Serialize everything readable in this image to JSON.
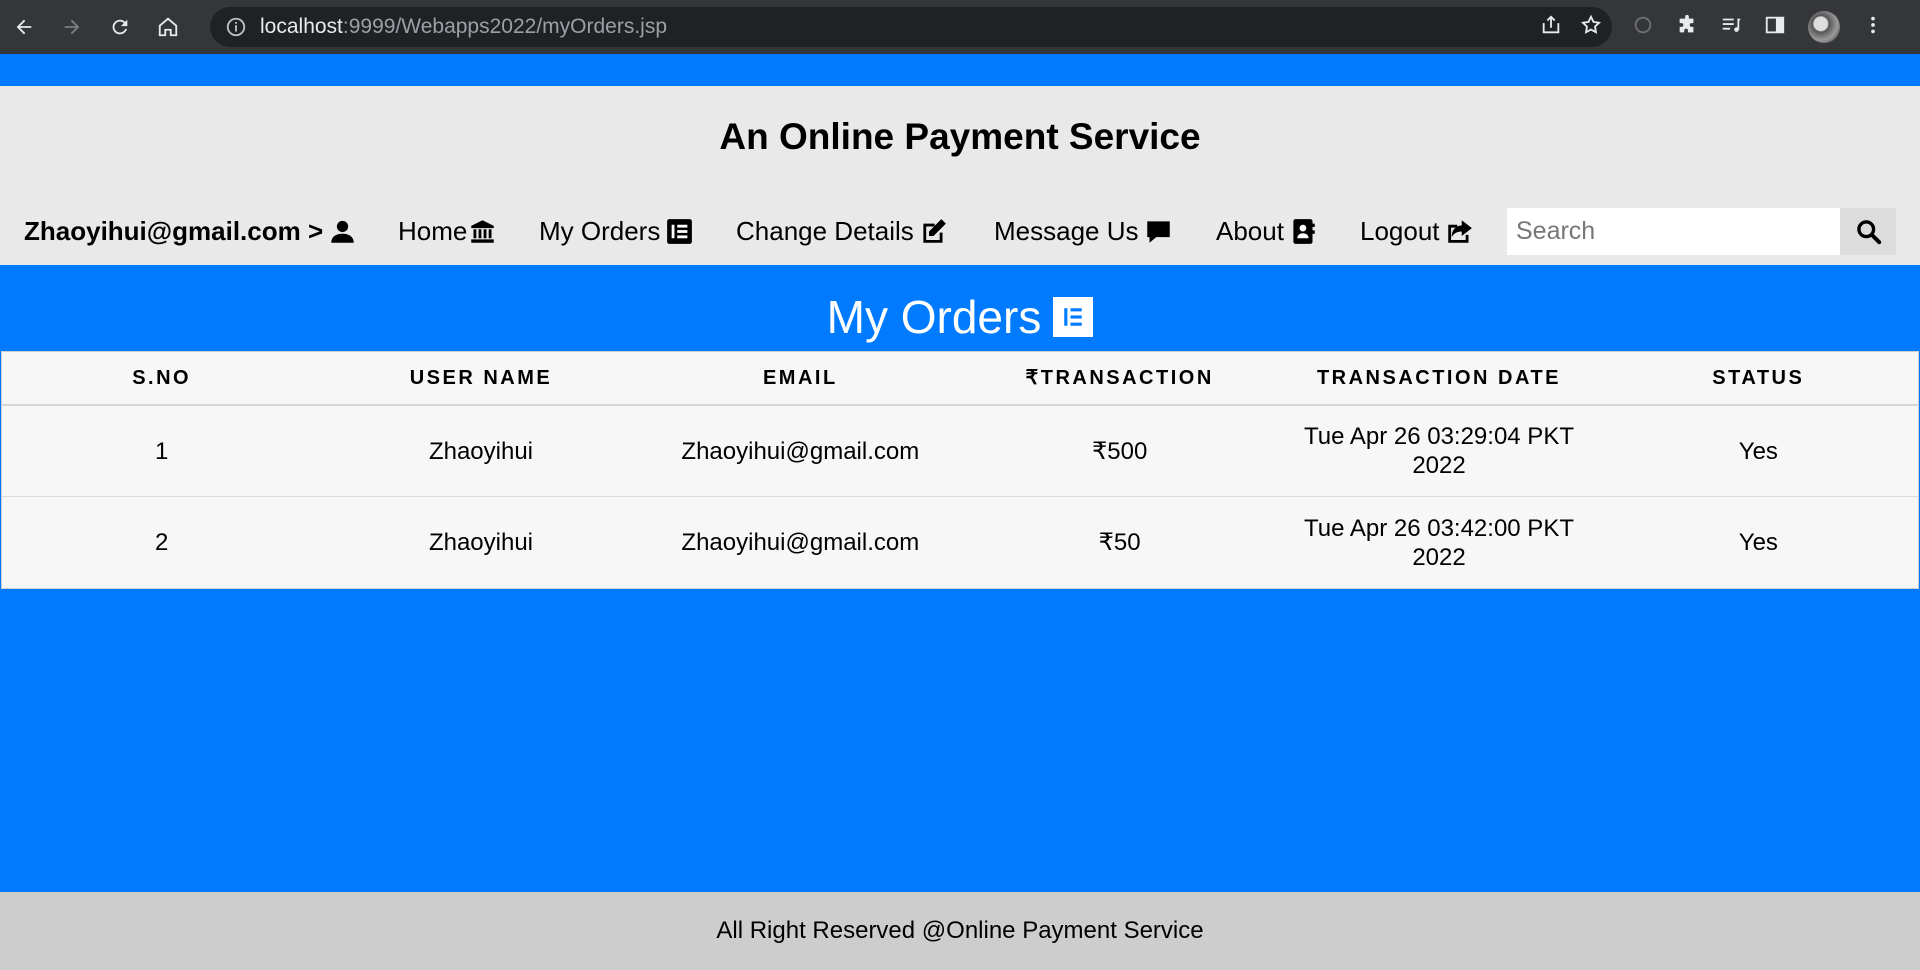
{
  "browser": {
    "url_host": "localhost",
    "url_rest": ":9999/Webapps2022/myOrders.jsp"
  },
  "header": {
    "site_title": "An Online Payment Service",
    "user_label": "Zhaoyihui@gmail.com >",
    "nav": {
      "home": "Home",
      "my_orders": "My Orders",
      "change_details": "Change Details",
      "message_us": "Message Us",
      "about": "About",
      "logout": "Logout"
    },
    "search": {
      "placeholder": "Search"
    }
  },
  "main": {
    "title": "My Orders",
    "table": {
      "columns": [
        "S.NO",
        "USER NAME",
        "EMAIL",
        "₹TRANSACTION",
        "TRANSACTION DATE",
        "STATUS"
      ],
      "rows": [
        [
          "1",
          "Zhaoyihui",
          "Zhaoyihui@gmail.com",
          "₹500",
          "Tue Apr 26 03:29:04 PKT 2022",
          "Yes"
        ],
        [
          "2",
          "Zhaoyihui",
          "Zhaoyihui@gmail.com",
          "₹50",
          "Tue Apr 26 03:42:00 PKT 2022",
          "Yes"
        ]
      ]
    }
  },
  "footer": {
    "text": "All Right Reserved @Online Payment Service"
  },
  "colors": {
    "accent": "#007bff",
    "header_bg": "#e9e9e9",
    "footer_bg": "#cdcdcd"
  },
  "icons": {
    "user": "user-icon",
    "home": "bank-icon",
    "my_orders": "list-alt-icon",
    "change_details": "edit-icon",
    "message_us": "comment-icon",
    "about": "address-book-icon",
    "logout": "share-square-icon",
    "search": "search-icon"
  }
}
